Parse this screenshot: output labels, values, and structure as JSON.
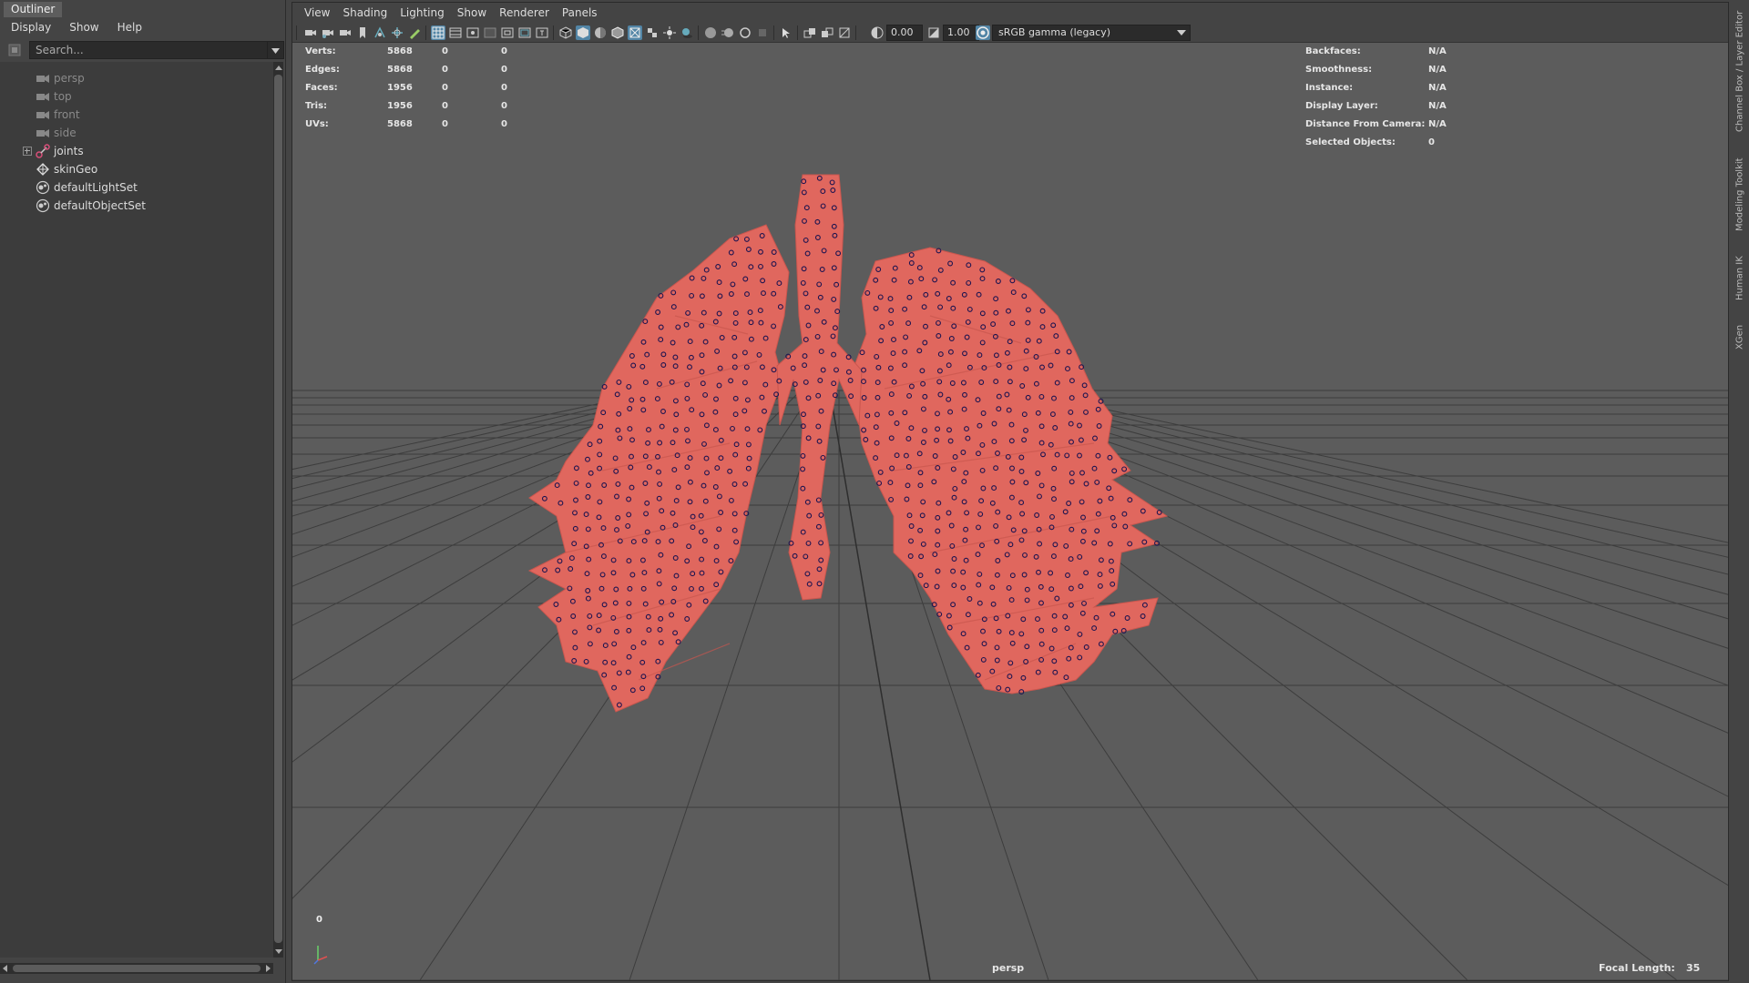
{
  "outliner": {
    "tab_title": "Outliner",
    "menu": [
      "Display",
      "Show",
      "Help"
    ],
    "search_placeholder": "Search...",
    "items": [
      {
        "label": "persp",
        "icon": "camera-icon",
        "state": "dim"
      },
      {
        "label": "top",
        "icon": "camera-icon",
        "state": "dim"
      },
      {
        "label": "front",
        "icon": "camera-icon",
        "state": "dim"
      },
      {
        "label": "side",
        "icon": "camera-icon",
        "state": "dim"
      },
      {
        "label": "joints",
        "icon": "joint-icon",
        "state": "normal",
        "expandable": true
      },
      {
        "label": "skinGeo",
        "icon": "mesh-icon",
        "state": "normal"
      },
      {
        "label": "defaultLightSet",
        "icon": "set-icon",
        "state": "normal"
      },
      {
        "label": "defaultObjectSet",
        "icon": "set-icon",
        "state": "normal"
      }
    ]
  },
  "viewport": {
    "menu": [
      "View",
      "Shading",
      "Lighting",
      "Show",
      "Renderer",
      "Panels"
    ],
    "toolbar": {
      "exposure": "0.00",
      "gamma": "1.00",
      "color_space": "sRGB gamma (legacy)"
    },
    "hud_left": [
      {
        "label": "Verts:",
        "v1": "5868",
        "v2": "0",
        "v3": "0"
      },
      {
        "label": "Edges:",
        "v1": "5868",
        "v2": "0",
        "v3": "0"
      },
      {
        "label": "Faces:",
        "v1": "1956",
        "v2": "0",
        "v3": "0"
      },
      {
        "label": "Tris:",
        "v1": "1956",
        "v2": "0",
        "v3": "0"
      },
      {
        "label": "UVs:",
        "v1": "5868",
        "v2": "0",
        "v3": "0"
      }
    ],
    "hud_right": [
      {
        "label": "Backfaces:",
        "value": "N/A"
      },
      {
        "label": "Smoothness:",
        "value": "N/A"
      },
      {
        "label": "Instance:",
        "value": "N/A"
      },
      {
        "label": "Display Layer:",
        "value": "N/A"
      },
      {
        "label": "Distance From Camera:",
        "value": "N/A"
      },
      {
        "label": "Selected Objects:",
        "value": "0"
      }
    ],
    "camera": "persp",
    "focal_length_label": "Focal Length:",
    "focal_length_value": "35",
    "frame": "0",
    "colors": {
      "mesh": "#e0675e",
      "mesh_dark": "#c9564e",
      "vertex": "#1e1450",
      "grid": "#3d3d3d"
    }
  },
  "side_tabs": [
    "Channel Box / Layer Editor",
    "Modeling Toolkit",
    "Human IK",
    "XGen"
  ]
}
